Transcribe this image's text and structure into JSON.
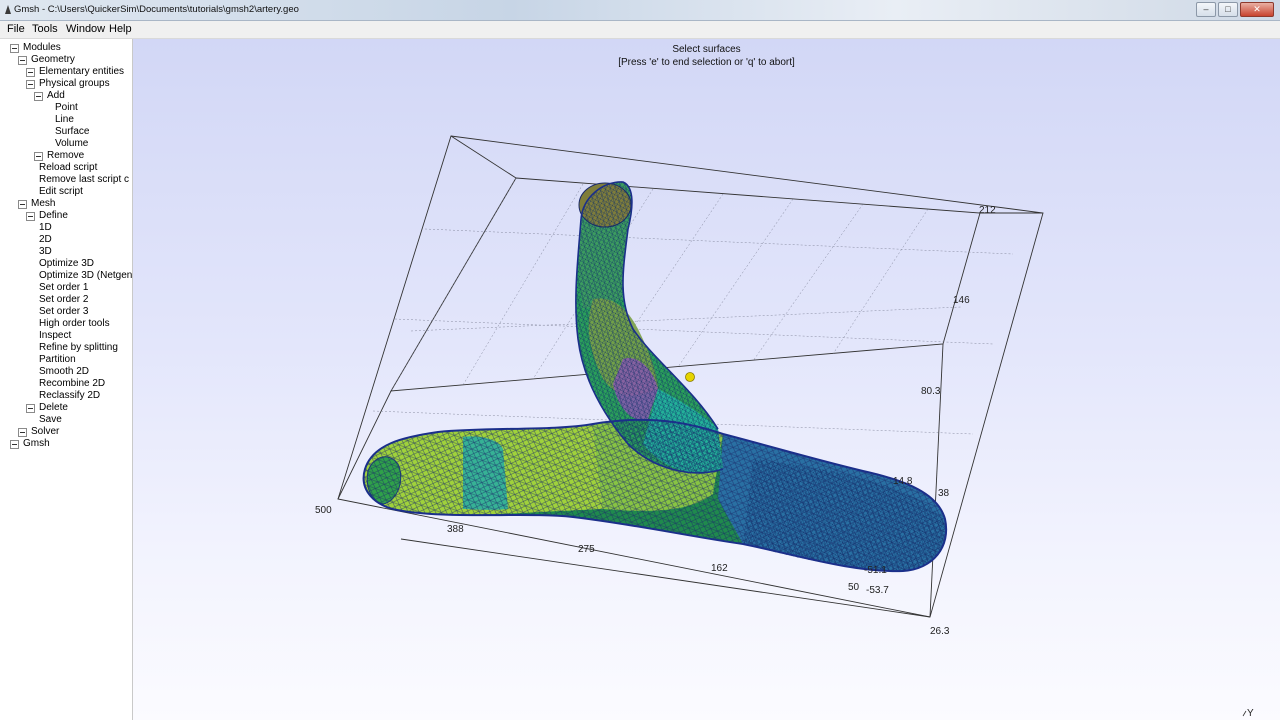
{
  "window": {
    "title": "Gmsh - C:\\Users\\QuickerSim\\Documents\\tutorials\\gmsh2\\artery.geo",
    "buttons": {
      "minimize": "–",
      "maximize": "□",
      "close": "✕"
    }
  },
  "menu": {
    "file": "File",
    "tools": "Tools",
    "window": "Window",
    "help": "Help"
  },
  "tree": {
    "modules": "Modules",
    "geometry": "Geometry",
    "elementary": "Elementary entities",
    "physical": "Physical groups",
    "add": "Add",
    "point": "Point",
    "line": "Line",
    "surface": "Surface",
    "volume": "Volume",
    "remove": "Remove",
    "reload": "Reload script",
    "remove_last": "Remove last script c",
    "edit": "Edit script",
    "mesh": "Mesh",
    "define": "Define",
    "m1d": "1D",
    "m2d": "2D",
    "m3d": "3D",
    "optimize3d": "Optimize 3D",
    "optimize3d_netgen": "Optimize 3D (Netgen",
    "order1": "Set order 1",
    "order2": "Set order 2",
    "order3": "Set order 3",
    "high_order": "High order tools",
    "inspect": "Inspect",
    "refine": "Refine by splitting",
    "partition": "Partition",
    "smooth": "Smooth 2D",
    "recombine": "Recombine 2D",
    "reclassify": "Reclassify 2D",
    "delete": "Delete",
    "save": "Save",
    "solver": "Solver",
    "gmsh": "Gmsh"
  },
  "viewport": {
    "message1": "Select surfaces",
    "message2": "[Press 'e' to end selection or 'q' to abort]",
    "axis_triad_label": "Y",
    "axis_labels": {
      "a500": "500",
      "a388": "388",
      "a275": "275",
      "a162": "162",
      "a50": "50",
      "a212": "212",
      "a146": "146",
      "a80": "80.3",
      "a148": "14.8",
      "a263": "26.3",
      "a511": "-51.1",
      "a537": "-53.7",
      "a38": "38"
    }
  }
}
